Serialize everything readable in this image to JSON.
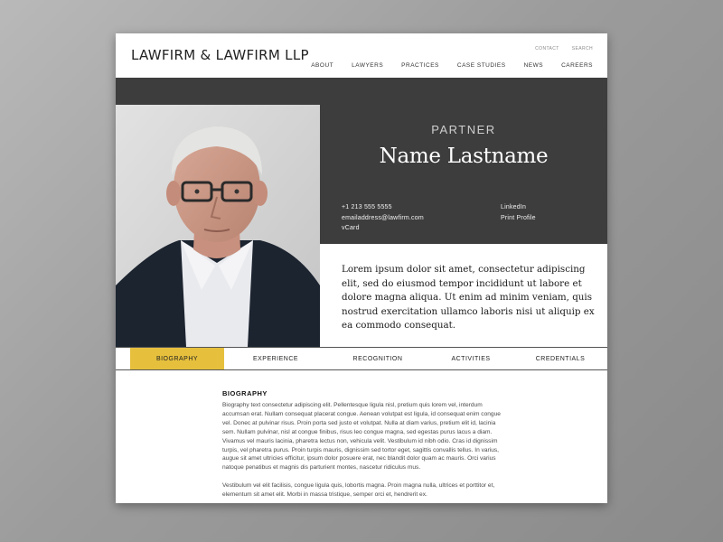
{
  "header": {
    "logo": "LAWFIRM & LAWFIRM LLP",
    "utility": [
      "CONTACT",
      "SEARCH"
    ],
    "nav": [
      "ABOUT",
      "LAWYERS",
      "PRACTICES",
      "CASE STUDIES",
      "NEWS",
      "CAREERS"
    ]
  },
  "profile": {
    "role": "PARTNER",
    "name": "Name Lastname",
    "phone": "+1 213 555 5555",
    "email": "emailaddress@lawfirm.com",
    "vcard": "vCard",
    "linkedin": "LinkedIn",
    "print": "Print Profile",
    "intro": "Lorem ipsum dolor sit amet, consectetur adipiscing elit, sed do eiusmod tempor incididunt ut labore et dolore magna aliqua. Ut enim ad minim veniam, quis nostrud exercitation ullamco laboris nisi ut aliquip ex ea commodo consequat."
  },
  "tabs": [
    "BIOGRAPHY",
    "EXPERIENCE",
    "RECOGNITION",
    "ACTIVITIES",
    "CREDENTIALS"
  ],
  "biography": {
    "title": "BIOGRAPHY",
    "paragraphs": [
      "Biography text consectetur adipiscing elit. Pellentesque ligula nisl, pretium quis lorem vel, interdum accumsan erat. Nullam consequat placerat congue. Aenean volutpat est ligula, id consequat enim congue vel. Donec at pulvinar risus. Proin porta sed justo et volutpat. Nulla at diam varius, pretium elit id, lacinia sem. Nullam pulvinar, nisl at congue finibus, risus leo congue magna, sed egestas purus lacus a diam. Vivamus vel mauris lacinia, pharetra lectus non, vehicula velit. Vestibulum id nibh odio. Cras id dignissim turpis, vel pharetra purus. Proin turpis mauris, dignissim sed tortor eget, sagittis convallis tellus. In varius, augue sit amet ultricies efficitur, ipsum dolor posuere erat, nec blandit dolor quam ac mauris. Orci varius natoque penatibus et magnis dis parturient montes, nascetur ridiculus mus.",
      "Vestibulum vel elit facilisis, congue ligula quis, lobortis magna. Proin magna nulla, ultrices et porttitor et, elementum sit amet elit. Morbi in massa tristique, semper orci et, hendrerit ex."
    ]
  },
  "colors": {
    "accent": "#e6c03d",
    "hero_dark": "#3d3d3d",
    "background": "#9c9c9c"
  }
}
